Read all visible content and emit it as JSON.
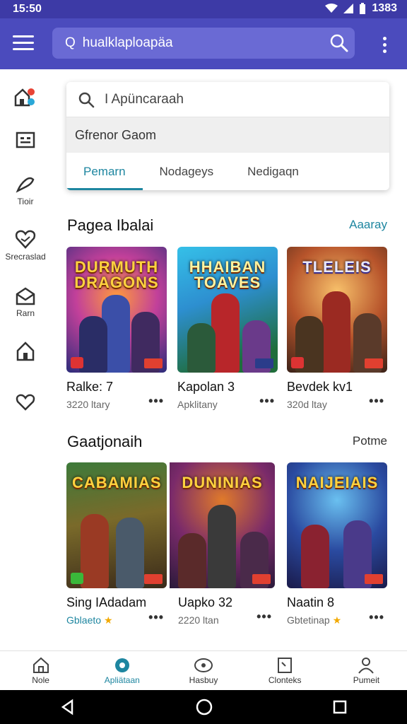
{
  "status_bar": {
    "time": "15:50",
    "battery": "1383"
  },
  "app_bar": {
    "search_text": "hualklaploapäa",
    "search_prefix": "Q"
  },
  "rail": {
    "items": [
      {
        "label": "",
        "icon": "home-apps-icon"
      },
      {
        "label": "",
        "icon": "card-icon"
      },
      {
        "label": "Tioir",
        "icon": "pen-icon"
      },
      {
        "label": "Srecraslad",
        "icon": "heart-badge-icon"
      },
      {
        "label": "Rarn",
        "icon": "mail-icon"
      },
      {
        "label": "",
        "icon": "home-icon"
      },
      {
        "label": "",
        "icon": "heart-icon"
      }
    ]
  },
  "dropdown": {
    "search_placeholder": "I Apüncaraah",
    "suggestion": "Gfrenor Gaom",
    "tabs": [
      {
        "label": "Pemarn",
        "active": true
      },
      {
        "label": "Nodageys",
        "active": false
      },
      {
        "label": "Nedigaqn",
        "active": false
      }
    ]
  },
  "section1": {
    "title": "Pagea Ibalai",
    "link": "Aaaray",
    "cards": [
      {
        "logo": "DURMUTH DRAGONS",
        "name": "Ralke: 7",
        "meta": "3220 ltary"
      },
      {
        "logo": "HHAIBAN TOAVES",
        "name": "Kapolan 3",
        "meta": "Apklitany"
      },
      {
        "logo": "TLELEIS",
        "name": "Bevdek kv1",
        "meta": "320d ltay"
      }
    ]
  },
  "section2": {
    "title": "Gaatjonaih",
    "link": "Potme",
    "cards": [
      {
        "logo": "CABAMIAS",
        "name": "Sing IAdadam",
        "meta": "Gblaeto",
        "meta_star": true
      },
      {
        "logo": "DUNINIAS",
        "name": "Uapko 32",
        "meta": "2220 ltan",
        "meta_star": false
      },
      {
        "logo": "NAIJEIAIS",
        "name": "Naatin 8",
        "meta": "Gbtetinap",
        "meta_star": true
      }
    ]
  },
  "bottom_nav": {
    "items": [
      {
        "label": "Nole",
        "active": false
      },
      {
        "label": "Apliätaan",
        "active": true
      },
      {
        "label": "Hasbuy",
        "active": false
      },
      {
        "label": "Clonteks",
        "active": false
      },
      {
        "label": "Pumeit",
        "active": false
      }
    ]
  },
  "colors": {
    "accent": "#1e86a0",
    "appbar": "#4b4bbd",
    "statusbar": "#3d3aa6",
    "star": "#f2a900"
  },
  "more_glyph": "•••",
  "star_glyph": "★"
}
